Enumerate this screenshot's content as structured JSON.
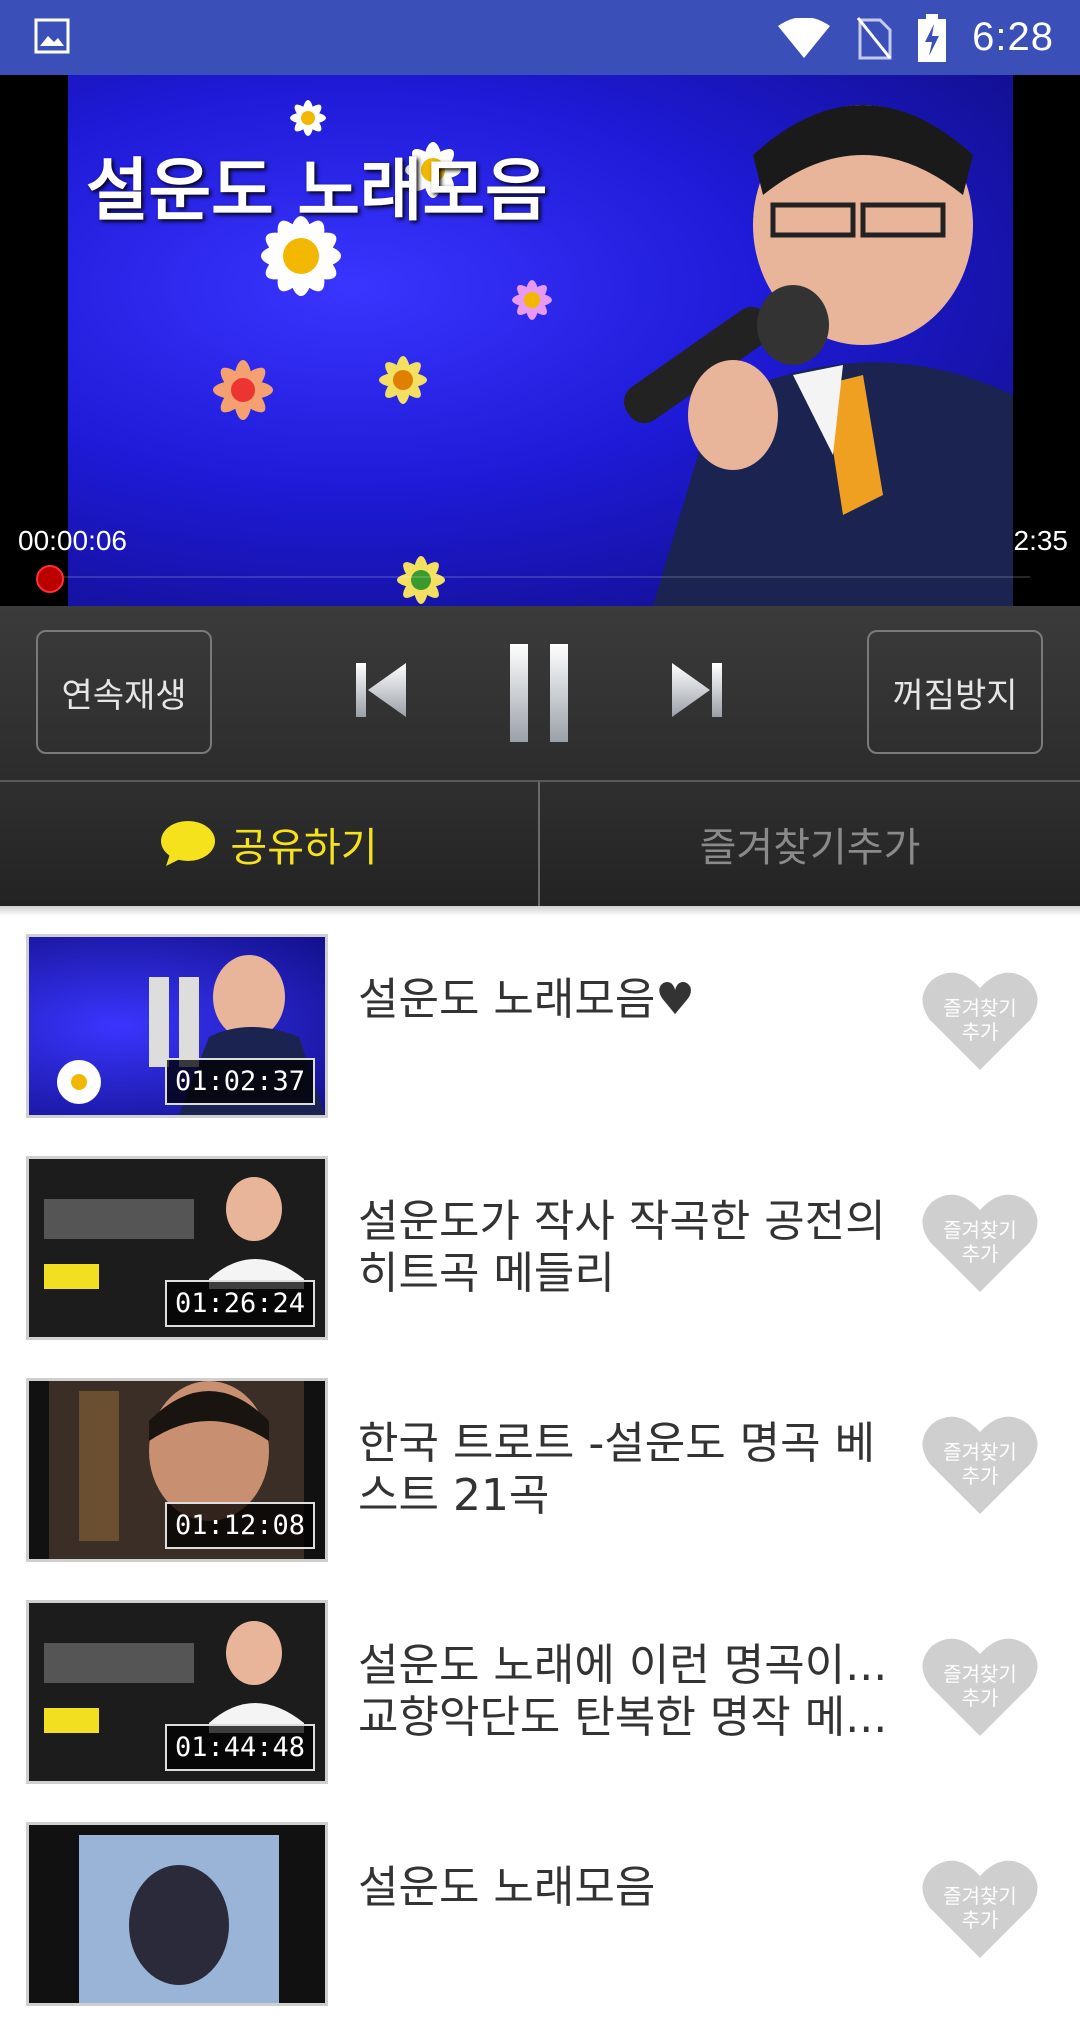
{
  "status_bar": {
    "time": "6:28",
    "icons": [
      "image-icon",
      "wifi-icon",
      "no-sim-icon",
      "battery-charging-icon"
    ]
  },
  "video": {
    "overlay_title": "설운도 노래모음",
    "elapsed": "00:00:06",
    "duration": "2:35",
    "progress_fraction": 0.04
  },
  "controls": {
    "continuous_label": "연속재생",
    "prevent_off_label": "꺼짐방지"
  },
  "actions": {
    "share_label": "공유하기",
    "favorite_label": "즐겨찾기추가"
  },
  "playlist": [
    {
      "title": "설운도 노래모음♥",
      "duration": "01:02:37",
      "fav_label_1": "즐겨찾기",
      "fav_label_2": "추가"
    },
    {
      "title": "설운도가 작사 작곡한 공전의 히트곡 메들리",
      "duration": "01:26:24",
      "fav_label_1": "즐겨찾기",
      "fav_label_2": "추가"
    },
    {
      "title": "한국 트로트 -설운도 명곡 베스트 21곡",
      "duration": "01:12:08",
      "fav_label_1": "즐겨찾기",
      "fav_label_2": "추가"
    },
    {
      "title": "설운도 노래에 이런 명곡이... 교향악단도 탄복한 명작 메...",
      "duration": "01:44:48",
      "fav_label_1": "즐겨찾기",
      "fav_label_2": "추가"
    },
    {
      "title": "설운도 노래모음",
      "duration": "",
      "fav_label_1": "즐겨찾기",
      "fav_label_2": "추가"
    }
  ],
  "colors": {
    "status_bar": "#3a50b8",
    "share_accent": "#f5e21c",
    "heart": "#cfcfcf"
  }
}
